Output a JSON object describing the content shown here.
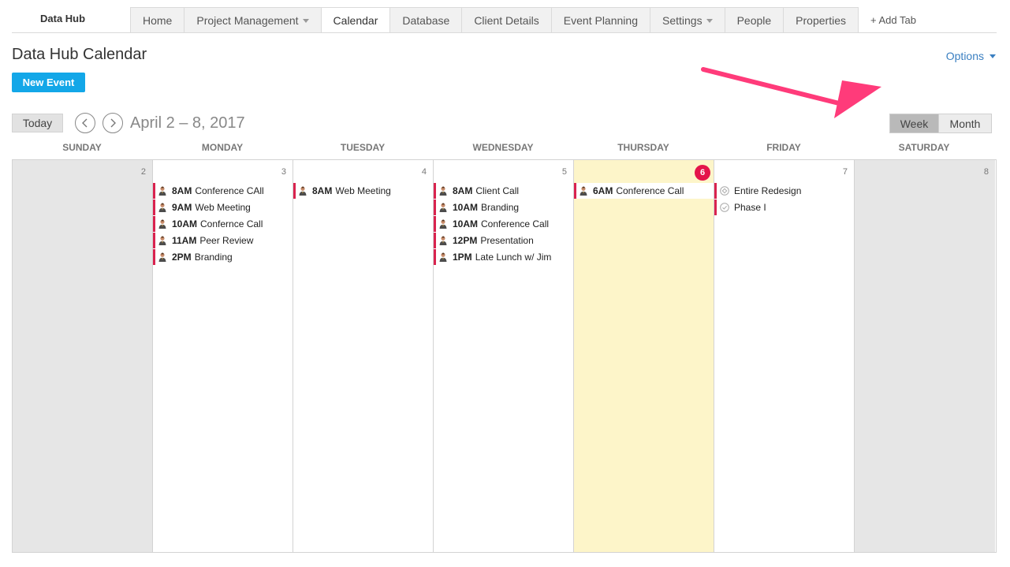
{
  "brand": "Data Hub",
  "tabs": [
    {
      "label": "Home"
    },
    {
      "label": "Project Management"
    },
    {
      "label": "Calendar"
    },
    {
      "label": "Database"
    },
    {
      "label": "Client Details"
    },
    {
      "label": "Event Planning"
    },
    {
      "label": "Settings"
    },
    {
      "label": "People"
    },
    {
      "label": "Properties"
    }
  ],
  "add_tab": "+ Add Tab",
  "page_title": "Data Hub Calendar",
  "options_label": "Options",
  "new_event_label": "New Event",
  "today_label": "Today",
  "date_range": "April 2 – 8, 2017",
  "views": {
    "week": "Week",
    "month": "Month",
    "selected": "Week"
  },
  "accent_color": "#d9234f",
  "button_color": "#13a7e8",
  "annotation_arrow_color": "#ff3b7a",
  "days": [
    {
      "name": "SUNDAY",
      "num": "2",
      "events": []
    },
    {
      "name": "MONDAY",
      "num": "3",
      "events": [
        {
          "time": "8AM",
          "title": "Conference CAll",
          "icon": "person-icon"
        },
        {
          "time": "9AM",
          "title": "Web Meeting",
          "icon": "person-icon"
        },
        {
          "time": "10AM",
          "title": "Confernce Call",
          "icon": "person-icon"
        },
        {
          "time": "11AM",
          "title": "Peer Review",
          "icon": "person-icon"
        },
        {
          "time": "2PM",
          "title": "Branding",
          "icon": "person-icon"
        }
      ]
    },
    {
      "name": "TUESDAY",
      "num": "4",
      "events": [
        {
          "time": "8AM",
          "title": "Web Meeting",
          "icon": "person-icon"
        }
      ]
    },
    {
      "name": "WEDNESDAY",
      "num": "5",
      "events": [
        {
          "time": "8AM",
          "title": "Client Call",
          "icon": "person-icon"
        },
        {
          "time": "10AM",
          "title": "Branding",
          "icon": "person-icon"
        },
        {
          "time": "10AM",
          "title": "Conference Call",
          "icon": "person-icon"
        },
        {
          "time": "12PM",
          "title": "Presentation",
          "icon": "person-icon"
        },
        {
          "time": "1PM",
          "title": "Late Lunch w/ Jim",
          "icon": "person-icon"
        }
      ]
    },
    {
      "name": "THURSDAY",
      "num": "6",
      "events": [
        {
          "time": "6AM",
          "title": "Conference Call",
          "icon": "person-icon"
        }
      ]
    },
    {
      "name": "FRIDAY",
      "num": "7",
      "events": [
        {
          "time": "",
          "title": "Entire Redesign",
          "icon": "milestone-icon"
        },
        {
          "time": "",
          "title": "Phase I",
          "icon": "check-circle-icon"
        }
      ]
    },
    {
      "name": "SATURDAY",
      "num": "8",
      "events": []
    }
  ]
}
